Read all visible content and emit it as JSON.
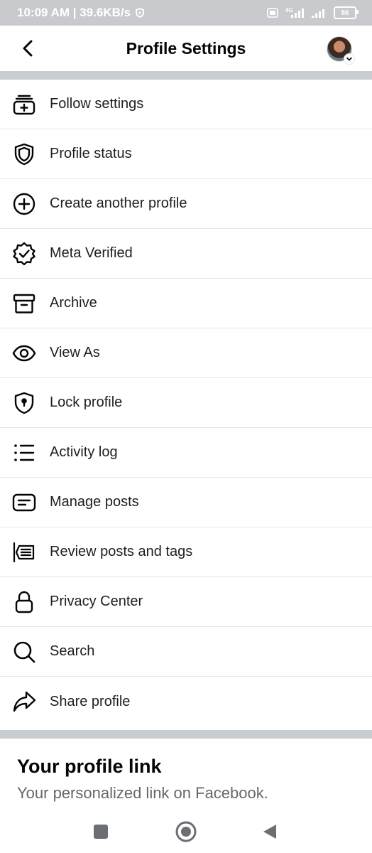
{
  "status_bar": {
    "time_speed": "10:09 AM | 39.6KB/s",
    "network": "4G",
    "battery": "86"
  },
  "header": {
    "title": "Profile Settings"
  },
  "menu": [
    {
      "label": "Follow settings",
      "icon": "follow-settings-icon"
    },
    {
      "label": "Profile status",
      "icon": "shield-icon"
    },
    {
      "label": "Create another profile",
      "icon": "plus-circle-icon"
    },
    {
      "label": "Meta Verified",
      "icon": "verified-badge-icon"
    },
    {
      "label": "Archive",
      "icon": "archive-box-icon"
    },
    {
      "label": "View As",
      "icon": "eye-icon"
    },
    {
      "label": "Lock profile",
      "icon": "lock-shield-icon"
    },
    {
      "label": "Activity log",
      "icon": "list-icon"
    },
    {
      "label": "Manage posts",
      "icon": "manage-posts-icon"
    },
    {
      "label": "Review posts and tags",
      "icon": "review-tags-icon"
    },
    {
      "label": "Privacy Center",
      "icon": "padlock-icon"
    },
    {
      "label": "Search",
      "icon": "search-icon"
    },
    {
      "label": "Share profile",
      "icon": "share-arrow-icon"
    }
  ],
  "profile_link": {
    "title": "Your profile link",
    "subtitle": "Your personalized link on Facebook."
  },
  "colors": {
    "separator": "#c9ccd1",
    "text": "#1c1e21",
    "secondary_text": "#65676b"
  }
}
